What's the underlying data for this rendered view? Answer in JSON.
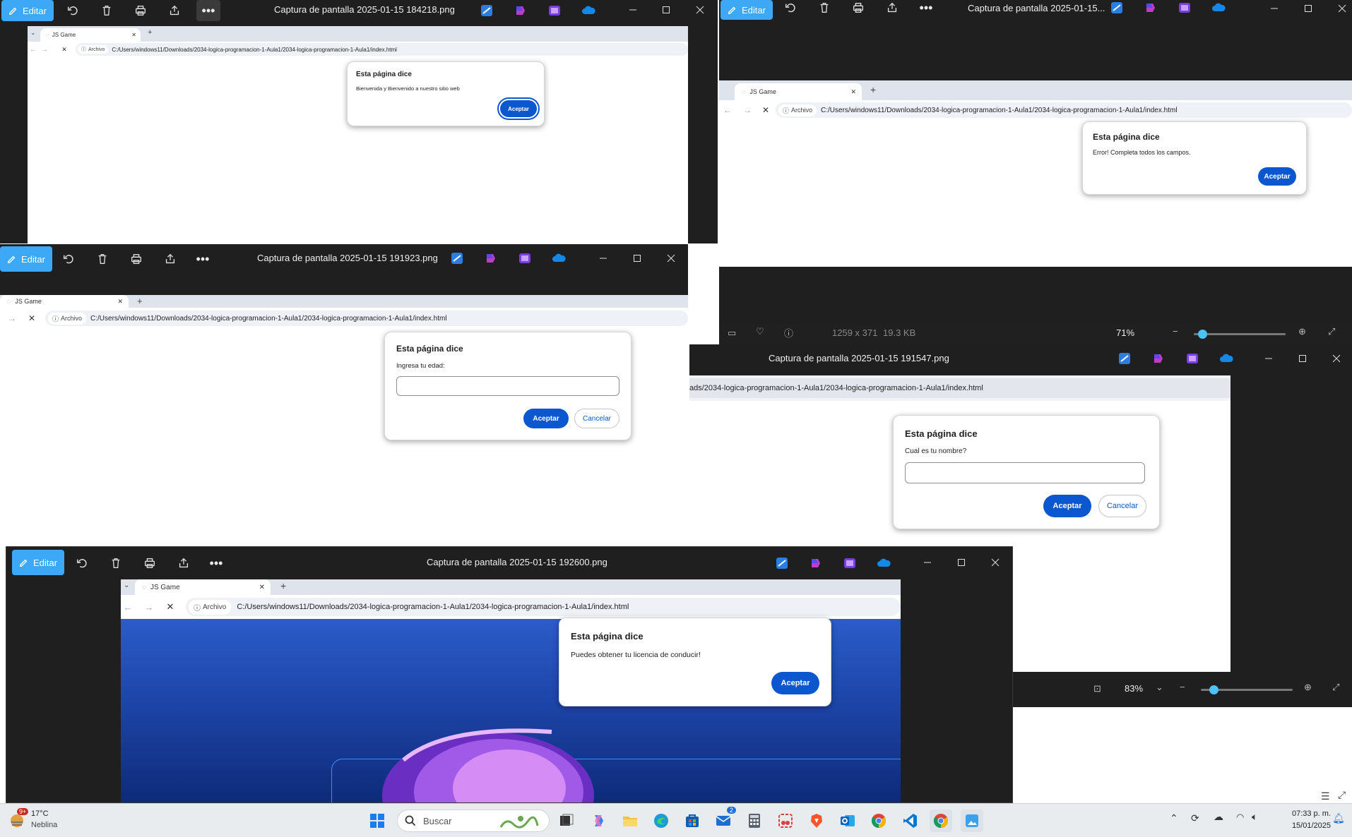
{
  "common": {
    "edit_label": "Editar",
    "tab_title": "JS Game",
    "archivo_chip": "Archivo",
    "dialog_title": "Esta página dice",
    "ok_label": "Aceptar",
    "cancel_label": "Cancelar",
    "url": "C:/Users/windows11/Downloads/2034-logica-programacion-1-Aula1/2034-logica-programacion-1-Aula1/index.html",
    "url_truncated": "ads/2034-logica-programacion-1-Aula1/2034-logica-programacion-1-Aula1/index.html"
  },
  "win1": {
    "title": "Captura de pantalla 2025-01-15 184218.png",
    "message": "Bienvenida y Bienvenido a nuestro sitio web"
  },
  "win2": {
    "title": "Captura de pantalla 2025-01-15...",
    "message": "Error! Completa todos los campos.",
    "info": {
      "dimensions": "1259 x 371",
      "size": "19.3 KB",
      "zoom": "71%"
    }
  },
  "win3": {
    "title": "Captura de pantalla 2025-01-15 191923.png",
    "message": "Ingresa tu edad:",
    "input_value": ""
  },
  "win4": {
    "title": "Captura de pantalla 2025-01-15 191547.png",
    "message": "Cual es tu nombre?",
    "input_value": "",
    "zoom": "83%"
  },
  "win5": {
    "title": "Captura de pantalla 2025-01-15 192600.png",
    "message": "Puedes obtener tu licencia de conducir!"
  },
  "taskbar": {
    "weather_temp": "17°C",
    "weather_desc": "Neblina",
    "weather_badge": "9+",
    "search_placeholder": "Buscar",
    "mail_badge": "2",
    "time": "07:33 p. m.",
    "date": "15/01/2025",
    "icons": [
      "start-icon",
      "search-icon",
      "task-view-icon",
      "copilot-icon",
      "file-explorer-icon",
      "edge-icon",
      "store-icon",
      "mail-icon",
      "calculator-icon",
      "snipping-tool-icon",
      "brave-icon",
      "outlook-icon",
      "chrome-icon",
      "vscode-icon",
      "chrome-icon",
      "photos-icon"
    ]
  },
  "colors": {
    "accent": "#3da8f5",
    "dialog_button": "#0b57d0",
    "titlebar": "#1f1f1f"
  }
}
